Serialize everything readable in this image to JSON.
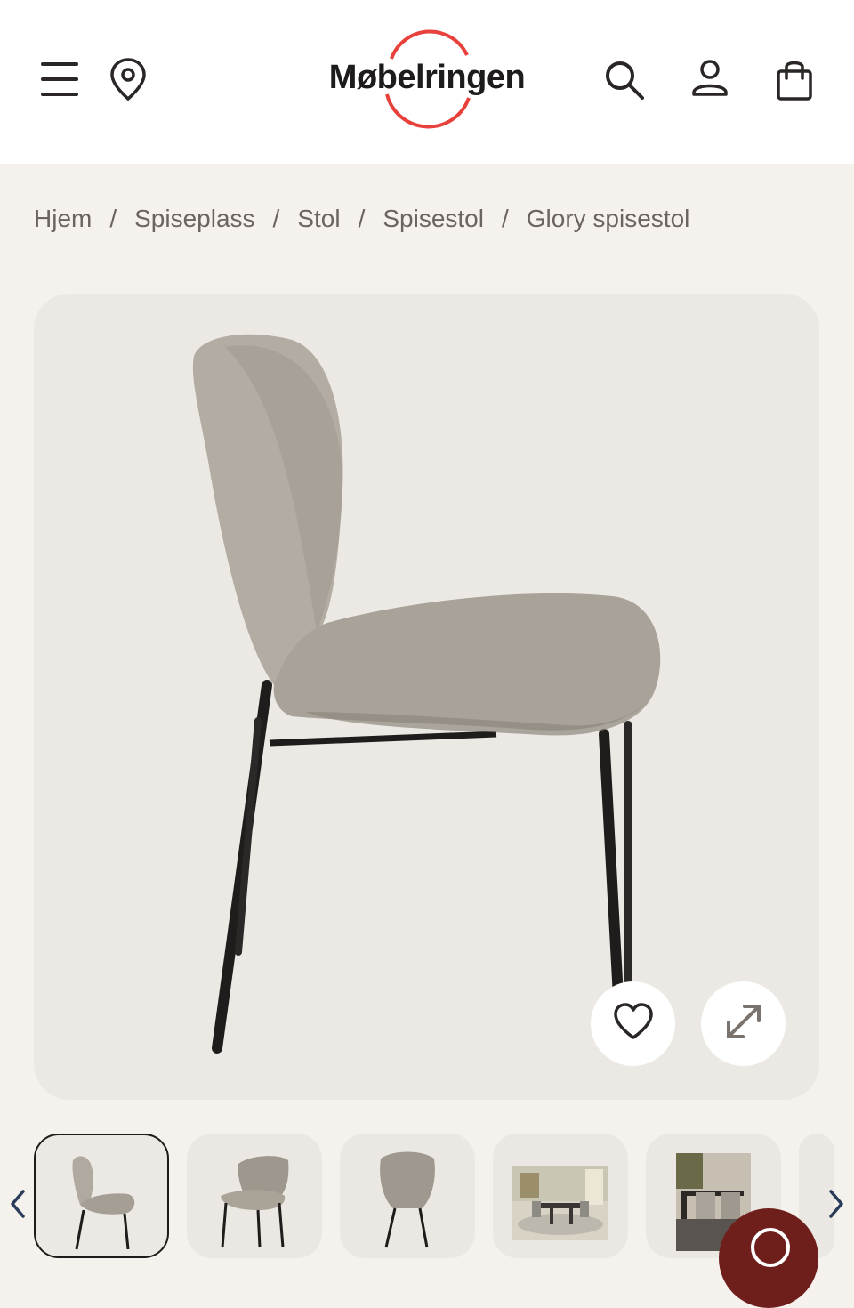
{
  "header": {
    "logo_text": "Møbelringen",
    "menu_icon": "hamburger-menu-icon",
    "location_icon": "map-pin-icon",
    "search_icon": "search-icon",
    "account_icon": "user-icon",
    "cart_icon": "shopping-bag-icon"
  },
  "breadcrumb": {
    "items": [
      "Hjem",
      "Spiseplass",
      "Stol",
      "Spisestol",
      "Glory spisestol"
    ],
    "separator": "/"
  },
  "product": {
    "favorite_icon": "heart-icon",
    "expand_icon": "expand-arrows-icon"
  },
  "thumbnails": {
    "count_visible": 6,
    "active_index": 0,
    "prev_icon": "chevron-left-icon",
    "next_icon": "chevron-right-icon"
  },
  "chat": {
    "icon": "chat-icon"
  },
  "colors": {
    "brand_red": "#e8403a",
    "page_bg": "#f5f2ee",
    "chat_bg": "#6e1f1c"
  }
}
